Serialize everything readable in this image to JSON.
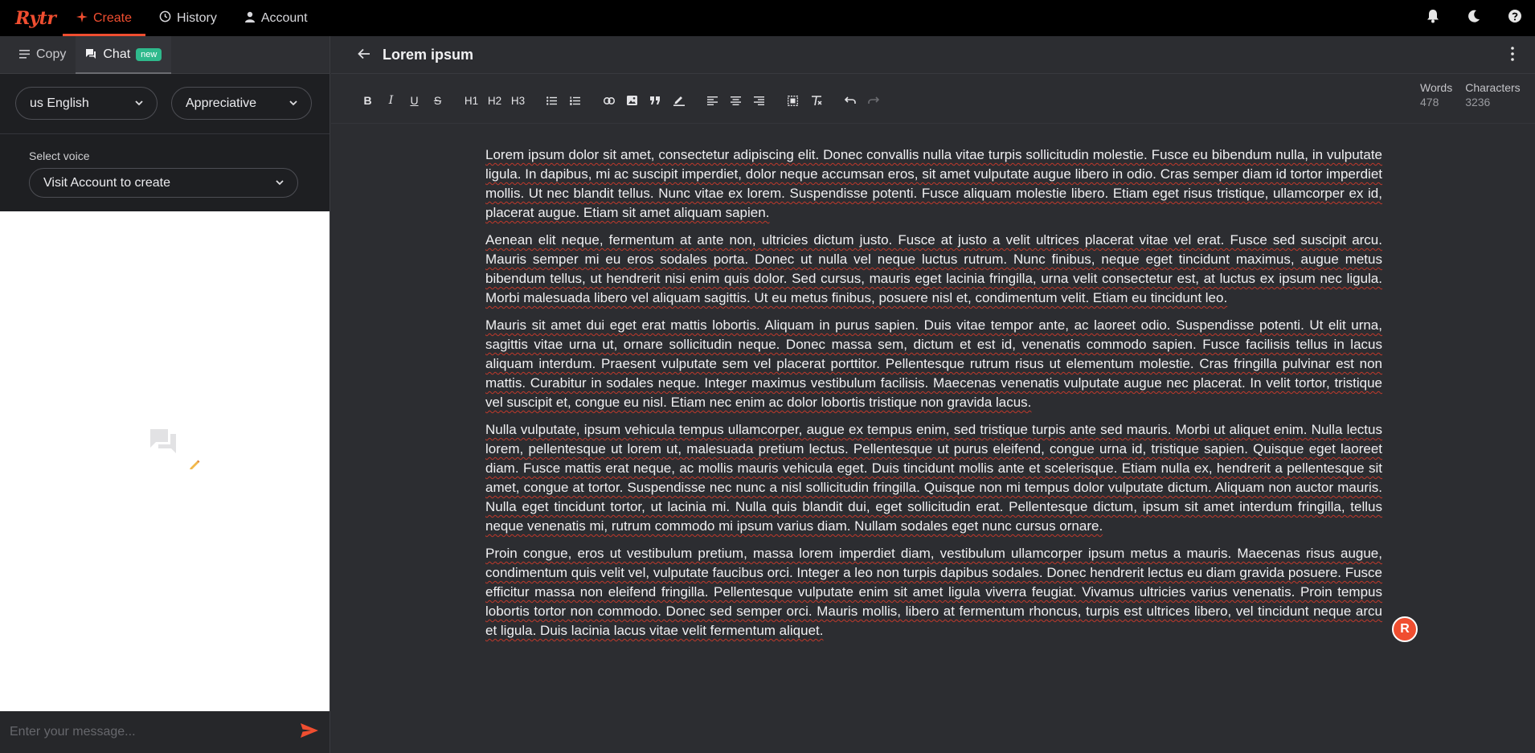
{
  "app": {
    "logo": "Rytr"
  },
  "nav": {
    "tabs": [
      {
        "label": "Create",
        "icon": "sparkle-icon",
        "active": true
      },
      {
        "label": "History",
        "icon": "history-icon",
        "active": false
      },
      {
        "label": "Account",
        "icon": "user-icon",
        "active": false
      }
    ],
    "right_icons": [
      "bell-icon",
      "moon-icon",
      "help-icon"
    ]
  },
  "sidebar": {
    "tabs": [
      {
        "label": "Copy",
        "icon": "lines-icon"
      },
      {
        "label": "Chat",
        "icon": "chat-icon",
        "badge": "new",
        "active": true
      }
    ],
    "language": "us English",
    "tone": "Appreciative",
    "voice_label": "Select voice",
    "voice_value": "Visit Account to create",
    "composer_placeholder": "Enter your message..."
  },
  "document": {
    "title": "Lorem ipsum",
    "words_label": "Words",
    "words_value": "478",
    "chars_label": "Characters",
    "chars_value": "3236",
    "toolbar": {
      "h1": "H1",
      "h2": "H2",
      "h3": "H3"
    },
    "paragraphs": [
      "Lorem ipsum dolor sit amet, consectetur adipiscing elit. Donec convallis nulla vitae turpis sollicitudin molestie. Fusce eu bibendum nulla, in vulputate ligula. In dapibus, mi ac suscipit imperdiet, dolor neque accumsan eros, sit amet vulputate augue libero in odio. Cras semper diam id tortor imperdiet mollis. Ut nec blandit tellus. Nunc vitae ex lorem. Suspendisse potenti. Fusce aliquam molestie libero. Etiam eget risus tristique, ullamcorper ex id, placerat augue. Etiam sit amet aliquam sapien.",
      "Aenean elit neque, fermentum at ante non, ultricies dictum justo. Fusce at justo a velit ultrices placerat vitae vel erat. Fusce sed suscipit arcu. Mauris semper mi eu eros sodales porta. Donec ut nulla vel neque luctus rutrum. Nunc finibus, neque eget tincidunt maximus, augue metus bibendum tellus, ut hendrerit nisi enim quis dolor. Sed cursus, mauris eget lacinia fringilla, urna velit consectetur est, at luctus ex ipsum nec ligula. Morbi malesuada libero vel aliquam sagittis. Ut eu metus finibus, posuere nisl et, condimentum velit. Etiam eu tincidunt leo.",
      "Mauris sit amet dui eget erat mattis lobortis. Aliquam in purus sapien. Duis vitae tempor ante, ac laoreet odio. Suspendisse potenti. Ut elit urna, sagittis vitae urna ut, ornare sollicitudin neque. Donec massa sem, dictum et est id, venenatis commodo sapien. Fusce facilisis tellus in lacus aliquam interdum. Praesent vulputate sem vel placerat porttitor. Pellentesque rutrum risus ut elementum molestie. Cras fringilla pulvinar est non mattis. Curabitur in sodales neque. Integer maximus vestibulum facilisis. Maecenas venenatis vulputate augue nec placerat. In velit tortor, tristique vel suscipit et, congue eu nisl. Etiam nec enim ac dolor lobortis tristique non gravida lacus.",
      "Nulla vulputate, ipsum vehicula tempus ullamcorper, augue ex tempus enim, sed tristique turpis ante sed mauris. Morbi ut aliquet enim. Nulla lectus lorem, pellentesque ut lorem ut, malesuada pretium lectus. Pellentesque ut purus eleifend, congue urna id, tristique sapien. Quisque eget laoreet diam. Fusce mattis erat neque, ac mollis mauris vehicula eget. Duis tincidunt mollis ante et scelerisque. Etiam nulla ex, hendrerit a pellentesque sit amet, congue at tortor. Suspendisse nec nunc a nisl sollicitudin fringilla. Quisque non mi tempus dolor vulputate dictum. Aliquam non auctor mauris. Nulla eget tincidunt tortor, ut lacinia mi. Nulla quis blandit dui, eget sollicitudin erat. Pellentesque dictum, ipsum sit amet interdum fringilla, tellus neque venenatis mi, rutrum commodo mi ipsum varius diam. Nullam sodales eget nunc cursus ornare.",
      "Proin congue, eros ut vestibulum pretium, massa lorem imperdiet diam, vestibulum ullamcorper ipsum metus a mauris. Maecenas risus augue, condimentum quis velit vel, vulputate faucibus orci. Integer a leo non turpis dapibus sodales. Donec hendrerit lectus eu diam gravida posuere. Fusce efficitur massa non eleifend fringilla. Pellentesque vulputate enim sit amet ligula viverra feugiat. Vivamus ultricies varius venenatis. Proin tempus lobortis tortor non commodo. Donec sed semper orci. Mauris mollis, libero at fermentum rhoncus, turpis est ultrices libero, vel tincidunt neque arcu et ligula. Duis lacinia lacus vitae velit fermentum aliquet."
    ],
    "floating_badge": "R"
  },
  "colors": {
    "accent": "#f04e30",
    "badge_new": "#2fb98c",
    "background": "#2c2d31",
    "sidebar": "#1e1f22"
  }
}
